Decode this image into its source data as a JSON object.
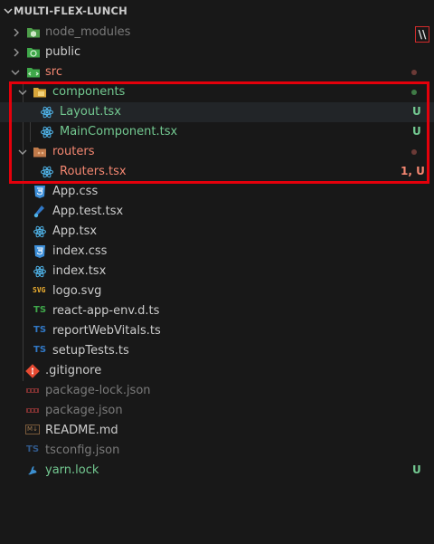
{
  "explorer": {
    "project_title": "MULTI-FLEX-LUNCH",
    "split_badge": "\\\\"
  },
  "tree": {
    "node_modules": {
      "label": "node_modules"
    },
    "public": {
      "label": "public"
    },
    "src": {
      "label": "src"
    },
    "components": {
      "label": "components"
    },
    "layout": {
      "label": "Layout.tsx",
      "status": "U"
    },
    "main_component": {
      "label": "MainComponent.tsx",
      "status": "U"
    },
    "routers": {
      "label": "routers"
    },
    "routers_tsx": {
      "label": "Routers.tsx",
      "status": "1, U"
    },
    "app_css": {
      "label": "App.css"
    },
    "app_test": {
      "label": "App.test.tsx"
    },
    "app_tsx": {
      "label": "App.tsx"
    },
    "index_css": {
      "label": "index.css"
    },
    "index_tsx": {
      "label": "index.tsx"
    },
    "logo_svg": {
      "label": "logo.svg"
    },
    "react_app_env": {
      "label": "react-app-env.d.ts"
    },
    "report_web_vitals": {
      "label": "reportWebVitals.ts"
    },
    "setup_tests": {
      "label": "setupTests.ts"
    },
    "gitignore": {
      "label": ".gitignore"
    },
    "package_lock": {
      "label": "package-lock.json"
    },
    "package_json": {
      "label": "package.json"
    },
    "readme": {
      "label": "README.md"
    },
    "tsconfig": {
      "label": "tsconfig.json"
    },
    "yarn_lock": {
      "label": "yarn.lock",
      "status": "U"
    }
  },
  "icon_text": {
    "ts": "TS",
    "svg": "SVG",
    "md": "M↓"
  },
  "colors": {
    "untracked": "#73c991",
    "error": "#f48771",
    "ignored": "#7a7a7a",
    "highlight_box": "#e4000b",
    "react": "#4fb3e8",
    "css": "#3d8fd9",
    "ts": "#3178c6"
  }
}
